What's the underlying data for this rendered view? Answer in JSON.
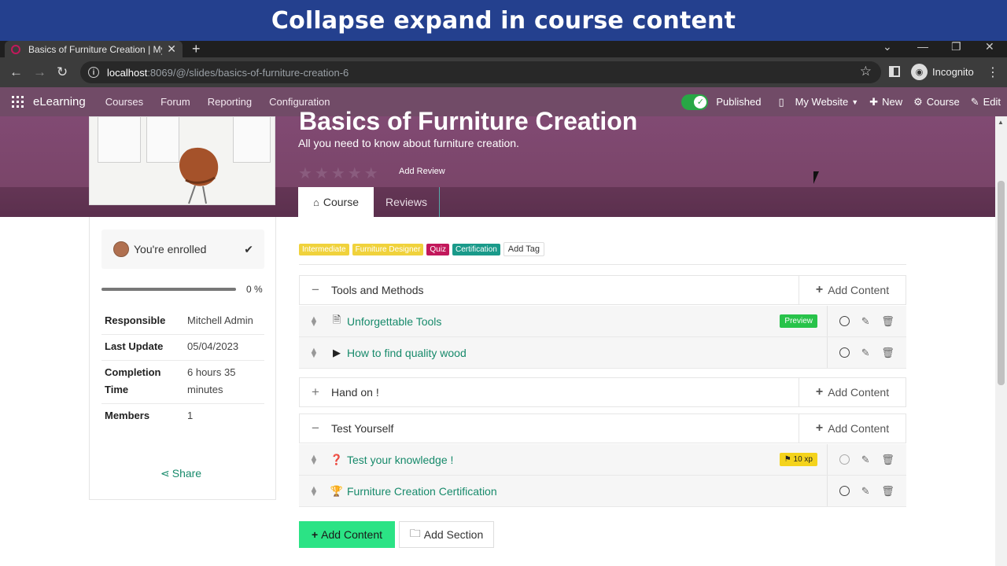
{
  "banner": {
    "title": "Collapse expand in course content"
  },
  "browser": {
    "tab_title": "Basics of Furniture Creation | My",
    "url_host": "localhost",
    "url_path": ":8069/@/slides/basics-of-furniture-creation-6",
    "incognito_label": "Incognito"
  },
  "navbar": {
    "app_name": "eLearning",
    "menu": [
      "Courses",
      "Forum",
      "Reporting",
      "Configuration"
    ],
    "published_label": "Published",
    "website_label": "My Website",
    "new_label": "New",
    "course_label": "Course",
    "edit_label": "Edit",
    "published_color": "#28a745",
    "brand_color": "#714b67"
  },
  "hero": {
    "title": "Basics of Furniture Creation",
    "subtitle": "All you need to know about furniture creation.",
    "rating_stars": 5,
    "add_review": "Add Review",
    "tabs": [
      "Course",
      "Reviews"
    ]
  },
  "sidebar": {
    "enrolled_label": "You're enrolled",
    "progress_label": "0 %",
    "progress_value": 0,
    "info": [
      {
        "key": "Responsible",
        "value": "Mitchell Admin"
      },
      {
        "key": "Last Update",
        "value": "05/04/2023"
      },
      {
        "key": "Completion Time",
        "value": "6 hours 35 minutes"
      },
      {
        "key": "Members",
        "value": "1"
      }
    ],
    "share_label": "Share"
  },
  "tags": [
    {
      "label": "Intermediate",
      "color": "#f0d23c"
    },
    {
      "label": "Furniture Designer",
      "color": "#f0d23c"
    },
    {
      "label": "Quiz",
      "color": "#c2185b"
    },
    {
      "label": "Certification",
      "color": "#1a9a8a"
    }
  ],
  "add_tag_label": "Add Tag",
  "content": {
    "add_content_label": "Add Content",
    "sections": [
      {
        "title": "Tools and Methods",
        "expanded": true,
        "toggle": "−",
        "lessons": [
          {
            "title": "Unforgettable Tools",
            "icon": "file-pdf-icon",
            "badge": "Preview",
            "badge_color": "#28c34a"
          },
          {
            "title": "How to find quality wood",
            "icon": "youtube-icon"
          }
        ]
      },
      {
        "title": "Hand on !",
        "expanded": false,
        "toggle": "+",
        "lessons": []
      },
      {
        "title": "Test Yourself",
        "expanded": true,
        "toggle": "−",
        "lessons": [
          {
            "title": "Test your knowledge !",
            "icon": "question-icon",
            "badge": "10 xp",
            "badge_color": "#f4d31c",
            "badge_icon": "flag-icon"
          },
          {
            "title": "Furniture Creation Certification",
            "icon": "trophy-icon"
          }
        ]
      }
    ],
    "footer_add_content": "Add Content",
    "footer_add_section": "Add Section"
  }
}
